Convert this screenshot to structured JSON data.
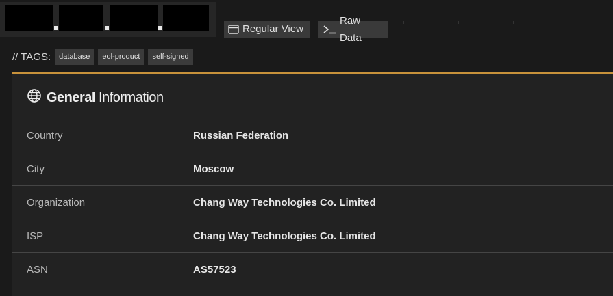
{
  "toolbar": {
    "regular_view_label": "Regular View",
    "regular_view_icon": "browser-window-icon",
    "raw_data_label": "Raw Data",
    "raw_data_icon": "terminal-prompt-icon"
  },
  "tags": {
    "label": "// TAGS:",
    "items": [
      "database",
      "eol-product",
      "self-signed"
    ]
  },
  "general": {
    "icon": "globe-icon",
    "title_bold": "General",
    "title_rest": " Information",
    "accent_color": "#c8923b",
    "rows": [
      {
        "label": "Country",
        "value": "Russian Federation"
      },
      {
        "label": "City",
        "value": "Moscow"
      },
      {
        "label": "Organization",
        "value": "Chang Way Technologies Co. Limited"
      },
      {
        "label": "ISP",
        "value": "Chang Way Technologies Co. Limited"
      },
      {
        "label": "ASN",
        "value": "AS57523"
      }
    ]
  }
}
